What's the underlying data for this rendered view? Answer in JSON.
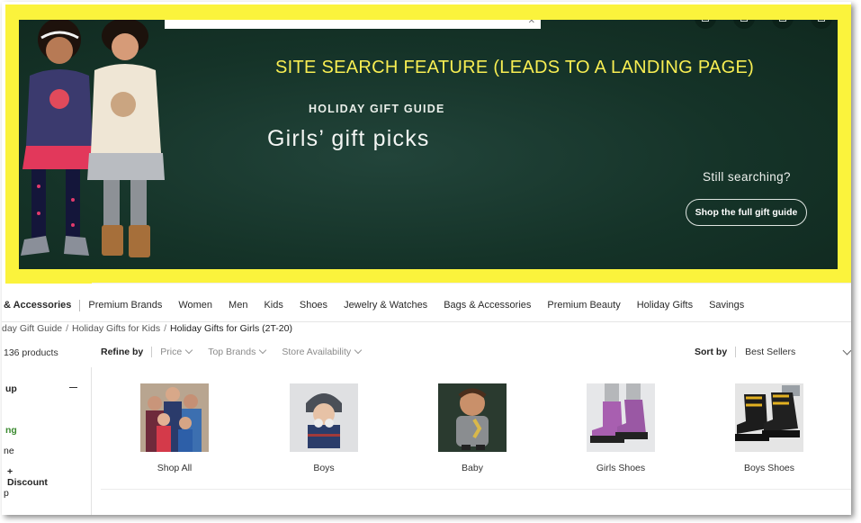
{
  "hero": {
    "annotation": "SITE SEARCH FEATURE (LEADS TO A LANDING PAGE)",
    "kicker": "HOLIDAY GIFT GUIDE",
    "title": "Girls’ gift picks",
    "still_searching": "Still searching?",
    "cta_label": "Shop the full gift guide",
    "colors": {
      "border": "#fbf33c",
      "background": "#153328",
      "annotation_text": "#f8ee52"
    }
  },
  "nav": {
    "items": [
      "& Accessories",
      "Premium Brands",
      "Women",
      "Men",
      "Kids",
      "Shoes",
      "Jewelry & Watches",
      "Bags & Accessories",
      "Premium Beauty",
      "Holiday Gifts",
      "Savings"
    ]
  },
  "breadcrumb": {
    "items": [
      "day Gift Guide",
      "Holiday Gifts for Kids",
      "Holiday Gifts for Girls (2T-20)"
    ],
    "separator": "/"
  },
  "results": {
    "count_label": "136 products"
  },
  "refine": {
    "label": "Refine by",
    "filters": [
      "Price",
      "Top Brands",
      "Store Availability"
    ]
  },
  "sort": {
    "label": "Sort by",
    "value": "Best Sellers"
  },
  "sidebar": {
    "items": [
      "up",
      "ng",
      "ne",
      "+ Discount",
      "p",
      "..."
    ],
    "active_color": "#3b8a30"
  },
  "tiles": [
    {
      "label": "Shop All",
      "icon": "group-photo"
    },
    {
      "label": "Boys",
      "icon": "boy-photo"
    },
    {
      "label": "Baby",
      "icon": "baby-photo"
    },
    {
      "label": "Girls Shoes",
      "icon": "girls-boots-photo"
    },
    {
      "label": "Boys Shoes",
      "icon": "boys-boots-photo"
    }
  ]
}
